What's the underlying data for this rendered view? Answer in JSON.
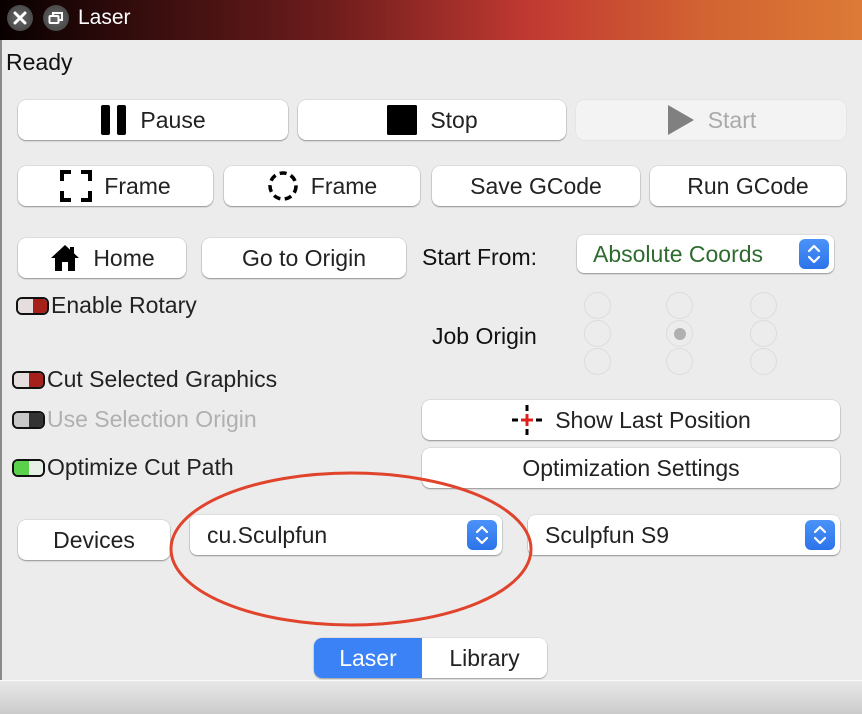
{
  "window": {
    "title": "Laser",
    "close_icon": "close-icon",
    "restore_icon": "restore-icon",
    "titlebar_gradient": [
      "#080000",
      "#6d1c1c",
      "#c23a32",
      "#dc7a36"
    ]
  },
  "status": "Ready",
  "controls": {
    "pause": {
      "label": "Pause",
      "icon": "pause-icon"
    },
    "stop": {
      "label": "Stop",
      "icon": "stop-icon"
    },
    "start": {
      "label": "Start",
      "icon": "play-icon",
      "enabled": false
    }
  },
  "frame_row": {
    "frame_rect": {
      "label": "Frame",
      "icon": "frame-rect-icon"
    },
    "frame_circle": {
      "label": "Frame",
      "icon": "frame-circle-icon"
    },
    "save_gcode": {
      "label": "Save GCode"
    },
    "run_gcode": {
      "label": "Run GCode"
    }
  },
  "position_row": {
    "home": {
      "label": "Home",
      "icon": "home-icon"
    },
    "go_to_origin": {
      "label": "Go to Origin"
    },
    "start_from_label": "Start From:",
    "start_from_value": "Absolute Coords",
    "start_from_color": "#2e6b2e"
  },
  "options": {
    "enable_rotary": {
      "label": "Enable Rotary",
      "state": "off"
    },
    "cut_selected_graphics": {
      "label": "Cut Selected Graphics",
      "state": "off"
    },
    "use_selection_origin": {
      "label": "Use Selection Origin",
      "state": "off",
      "enabled": false
    },
    "optimize_cut_path": {
      "label": "Optimize Cut Path",
      "state": "on"
    }
  },
  "job_origin": {
    "label": "Job Origin",
    "selected": "center",
    "positions": [
      "top-left",
      "top-center",
      "top-right",
      "middle-left",
      "center",
      "middle-right",
      "bottom-left",
      "bottom-center",
      "bottom-right"
    ]
  },
  "show_last_position": {
    "label": "Show Last Position",
    "icon": "crosshair-icon"
  },
  "optimization_settings": {
    "label": "Optimization Settings"
  },
  "devices": {
    "button_label": "Devices",
    "port_value": "cu.Sculpfun",
    "profile_value": "Sculpfun S9"
  },
  "tabs": [
    {
      "label": "Laser",
      "active": true
    },
    {
      "label": "Library",
      "active": false
    }
  ],
  "colors": {
    "accent_blue": "#3b82f6",
    "toggle_off_red": "#a52019",
    "toggle_on_green": "#5ad14a",
    "annotation_red": "#e0442c"
  }
}
